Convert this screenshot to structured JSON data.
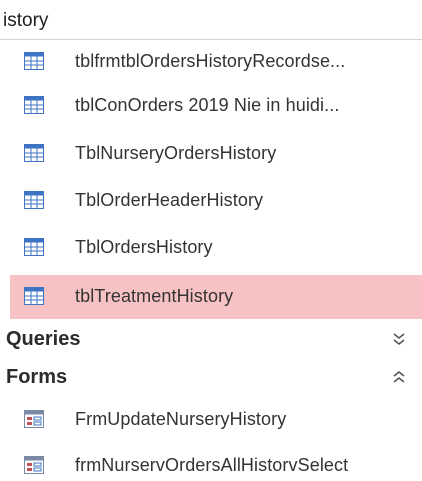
{
  "tables_group": {
    "title": "istory"
  },
  "tables": [
    {
      "label": "tblfrmtblOrdersHistoryRecordse..."
    },
    {
      "label": "tblConOrders 2019 Nie in huidi..."
    },
    {
      "label": "TblNurseryOrdersHistory"
    },
    {
      "label": "TblOrderHeaderHistory"
    },
    {
      "label": "TblOrdersHistory"
    },
    {
      "label": "tblTreatmentHistory",
      "selected": true
    }
  ],
  "queries_group": {
    "title": "Queries",
    "state": "collapsed",
    "chevron": "double-chevron-down-icon"
  },
  "forms_group": {
    "title": "Forms",
    "state": "expanded",
    "chevron": "double-chevron-up-icon"
  },
  "forms": [
    {
      "label": "FrmUpdateNurseryHistory"
    },
    {
      "label": "frmNurservOrdersAllHistorvSelect"
    }
  ],
  "icons": {
    "table": "table-icon",
    "form": "form-icon"
  },
  "colors": {
    "selection": "#f7c2c4",
    "table_icon_blue": "#3f74c4",
    "form_icon_red": "#c0505a"
  }
}
